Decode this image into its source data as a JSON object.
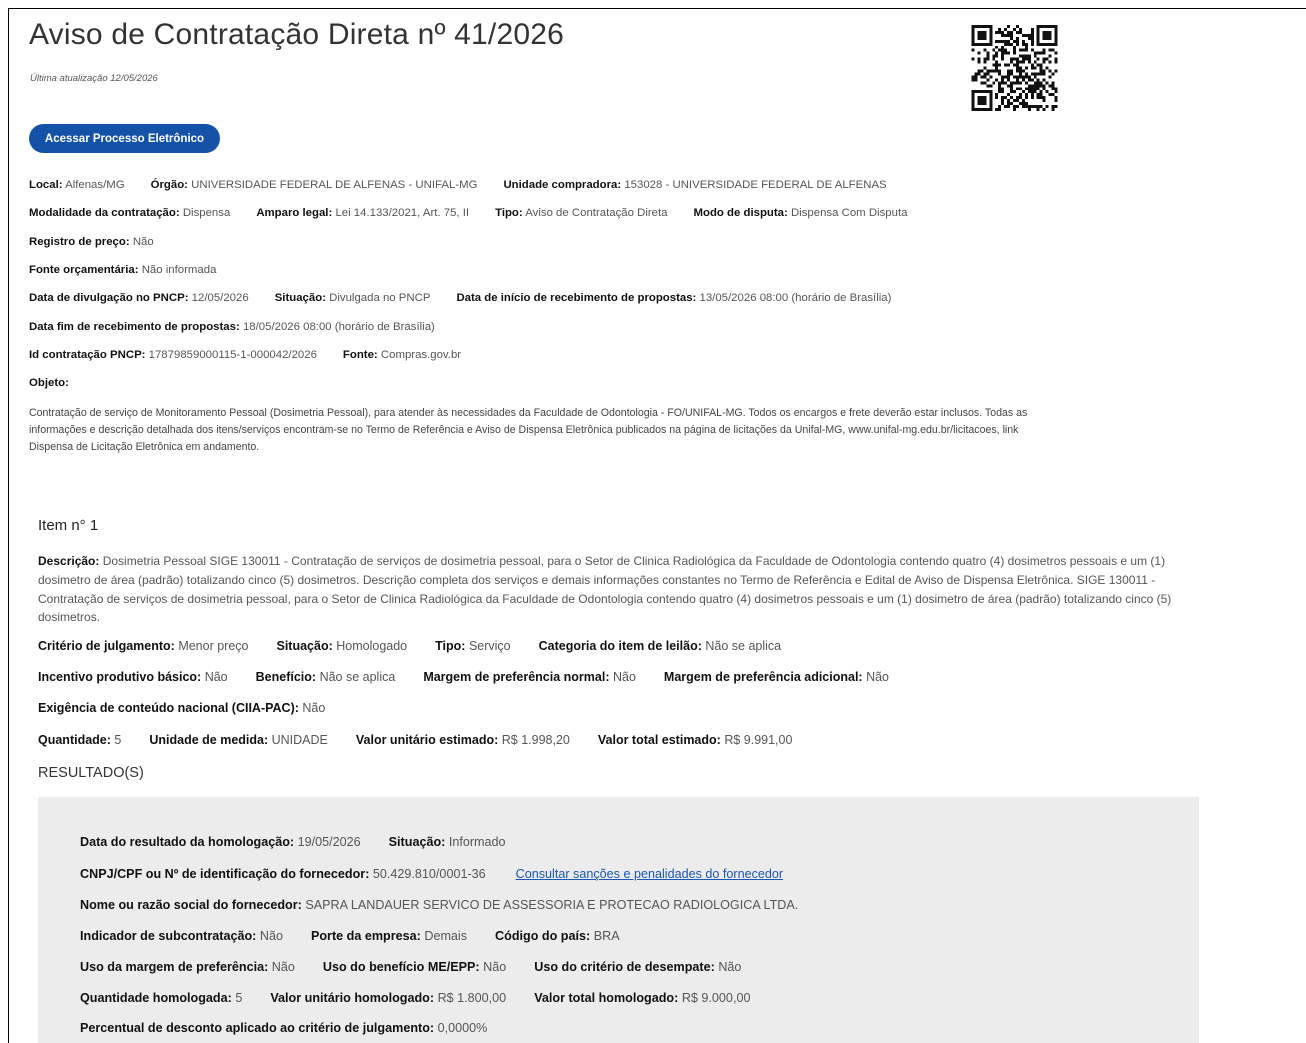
{
  "header": {
    "title": "Aviso de Contratação Direta nº 41/2026",
    "last_update": "Última atualização 12/05/2026",
    "button_label": "Acessar Processo Eletrônico"
  },
  "info": [
    [
      [
        "Local:",
        "Alfenas/MG"
      ],
      [
        "Órgão:",
        "UNIVERSIDADE FEDERAL DE ALFENAS - UNIFAL-MG"
      ],
      [
        "Unidade compradora:",
        "153028 - UNIVERSIDADE FEDERAL DE ALFENAS"
      ]
    ],
    [
      [
        "Modalidade da contratação:",
        "Dispensa"
      ],
      [
        "Amparo legal:",
        "Lei 14.133/2021, Art. 75, II"
      ],
      [
        "Tipo:",
        "Aviso de Contratação Direta"
      ],
      [
        "Modo de disputa:",
        "Dispensa Com Disputa"
      ]
    ],
    [
      [
        "Registro de preço:",
        "Não"
      ]
    ],
    [
      [
        "Fonte orçamentária:",
        "Não informada"
      ]
    ],
    [
      [
        "Data de divulgação no PNCP:",
        "12/05/2026"
      ],
      [
        "Situação:",
        "Divulgada no PNCP"
      ],
      [
        "Data de início de recebimento de propostas:",
        "13/05/2026 08:00 (horário de Brasília)"
      ]
    ],
    [
      [
        "Data fim de recebimento de propostas:",
        "18/05/2026 08:00 (horário de Brasília)"
      ]
    ],
    [
      [
        "Id contratação PNCP:",
        "17879859000115-1-000042/2026"
      ],
      [
        "Fonte:",
        "Compras.gov.br"
      ]
    ],
    [
      [
        "Objeto:",
        ""
      ]
    ]
  ],
  "objeto_text": "Contratação de serviço de Monitoramento Pessoal (Dosimetria Pessoal), para atender às necessidades da Faculdade de Odontologia - FO/UNIFAL-MG. Todos os encargos e frete deverão estar inclusos. Todas as informações e descrição detalhada dos itens/serviços encontram-se no Termo de Referência e Aviso de Dispensa Eletrônica publicados na página de licitações da Unifal-MG, www.unifal-mg.edu.br/licitacoes, link Dispensa de Licitação Eletrônica em andamento.",
  "item": {
    "title": "Item n° 1",
    "desc_label": "Descrição:",
    "desc_text": "Dosimetria Pessoal SIGE 130011 - Contratação de serviços de dosimetria pessoal, para o Setor de Clinica Radiológica da Faculdade de Odontologia contendo quatro (4) dosimetros pessoais e um (1) dosimetro de área (padrão) totalizando cinco (5) dosimetros. Descrição completa dos serviços e demais informações constantes no Termo de Referência e Edital de Aviso de Dispensa Eletrônica. SIGE 130011 - Contratação de serviços de dosimetria pessoal, para o Setor de Clinica Radiológica da Faculdade de Odontologia contendo quatro (4) dosimetros pessoais e um (1) dosimetro de área (padrão) totalizando cinco (5) dosimetros.",
    "rows": [
      [
        [
          "Critério de julgamento:",
          "Menor preço"
        ],
        [
          "Situação:",
          "Homologado"
        ],
        [
          "Tipo:",
          "Serviço"
        ],
        [
          "Categoria do item de leilão:",
          "Não se aplica"
        ]
      ],
      [
        [
          "Incentivo produtivo básico:",
          "Não"
        ],
        [
          "Benefício:",
          "Não se aplica"
        ],
        [
          "Margem de preferência normal:",
          "Não"
        ],
        [
          "Margem de preferência adicional:",
          "Não"
        ]
      ],
      [
        [
          "Exigência de conteúdo nacional (CIIA-PAC):",
          "Não"
        ]
      ],
      [
        [
          "Quantidade:",
          "5"
        ],
        [
          "Unidade de medida:",
          "UNIDADE"
        ],
        [
          "Valor unitário estimado:",
          "R$ 1.998,20"
        ],
        [
          "Valor total estimado:",
          "R$ 9.991,00"
        ]
      ]
    ]
  },
  "results": {
    "title": "RESULTADO(S)",
    "link_label": "Consultar sanções e penalidades do fornecedor",
    "rows": [
      [
        [
          "Data do resultado da homologação:",
          "19/05/2026"
        ],
        [
          "Situação:",
          "Informado"
        ]
      ],
      [
        [
          "CNPJ/CPF ou Nº de identificação do fornecedor:",
          "50.429.810/0001-36"
        ]
      ],
      [
        [
          "Nome ou razão social do fornecedor:",
          "SAPRA LANDAUER SERVICO DE ASSESSORIA E PROTECAO RADIOLOGICA LTDA."
        ]
      ],
      [
        [
          "Indicador de subcontratação:",
          "Não"
        ],
        [
          "Porte da empresa:",
          "Demais"
        ],
        [
          "Código do país:",
          "BRA"
        ]
      ],
      [
        [
          "Uso da margem de preferência:",
          "Não"
        ],
        [
          "Uso do benefício ME/EPP:",
          "Não"
        ],
        [
          "Uso do critério de desempate:",
          "Não"
        ]
      ],
      [
        [
          "Quantidade homologada:",
          "5"
        ],
        [
          "Valor unitário homologado:",
          "R$ 1.800,00"
        ],
        [
          "Valor total homologado:",
          "R$ 9.000,00"
        ]
      ],
      [
        [
          "Percentual de desconto aplicado ao critério de julgamento:",
          "0,0000%"
        ]
      ]
    ]
  },
  "qr_icon": "qr-code-icon",
  "colors": {
    "button": "#1452a8",
    "link": "#1a57b5",
    "panel": "#ececec"
  }
}
